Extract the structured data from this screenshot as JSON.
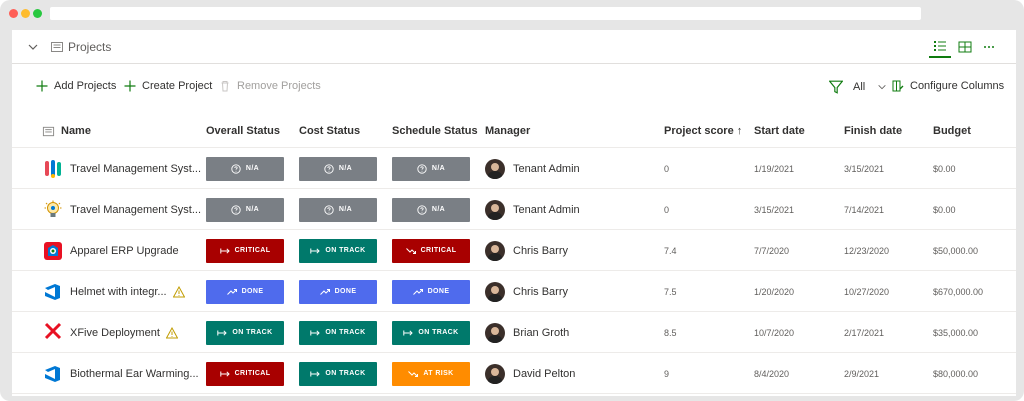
{
  "section": {
    "title": "Projects"
  },
  "toolbar": {
    "add": "Add Projects",
    "create": "Create Project",
    "remove": "Remove Projects",
    "filter": "All",
    "configure": "Configure Columns"
  },
  "columns": {
    "name": "Name",
    "overall": "Overall Status",
    "cost": "Cost Status",
    "schedule": "Schedule Status",
    "manager": "Manager",
    "score": "Project score",
    "score_sort": "↑",
    "start": "Start date",
    "finish": "Finish date",
    "budget": "Budget"
  },
  "colors": {
    "na": "#7a7f85",
    "critical": "#a80000",
    "ontrack": "#00796b",
    "done": "#4f6bed",
    "atrisk": "#ff8c00",
    "accent_green": "#107c10"
  },
  "rows": [
    {
      "name": "Travel Management Syst...",
      "icon": "travel-icon",
      "warning": false,
      "overall": "N/A",
      "overall_kind": "na",
      "cost": "N/A",
      "cost_kind": "na",
      "schedule": "N/A",
      "schedule_kind": "na",
      "manager": "Tenant Admin",
      "score": "0",
      "start": "1/19/2021",
      "finish": "3/15/2021",
      "budget": "$0.00"
    },
    {
      "name": "Travel Management Syst...",
      "icon": "idea-icon",
      "warning": false,
      "overall": "N/A",
      "overall_kind": "na",
      "cost": "N/A",
      "cost_kind": "na",
      "schedule": "N/A",
      "schedule_kind": "na",
      "manager": "Tenant Admin",
      "score": "0",
      "start": "3/15/2021",
      "finish": "7/14/2021",
      "budget": "$0.00"
    },
    {
      "name": "Apparel ERP Upgrade",
      "icon": "apparel-icon",
      "warning": false,
      "overall": "CRITICAL",
      "overall_kind": "critical",
      "cost": "ON TRACK",
      "cost_kind": "ontrack",
      "schedule": "CRITICAL",
      "schedule_kind": "critical",
      "manager": "Chris Barry",
      "score": "7.4",
      "start": "7/7/2020",
      "finish": "12/23/2020",
      "budget": "$50,000.00"
    },
    {
      "name": "Helmet with integr...",
      "icon": "azure-icon",
      "warning": true,
      "overall": "DONE",
      "overall_kind": "done",
      "cost": "DONE",
      "cost_kind": "done",
      "schedule": "DONE",
      "schedule_kind": "done",
      "manager": "Chris Barry",
      "score": "7.5",
      "start": "1/20/2020",
      "finish": "10/27/2020",
      "budget": "$670,000.00"
    },
    {
      "name": "XFive Deployment",
      "icon": "xfive-icon",
      "warning": true,
      "overall": "ON TRACK",
      "overall_kind": "ontrack",
      "cost": "ON TRACK",
      "cost_kind": "ontrack",
      "schedule": "ON TRACK",
      "schedule_kind": "ontrack",
      "manager": "Brian Groth",
      "score": "8.5",
      "start": "10/7/2020",
      "finish": "2/17/2021",
      "budget": "$35,000.00"
    },
    {
      "name": "Biothermal Ear Warming...",
      "icon": "azure-icon",
      "warning": false,
      "overall": "CRITICAL",
      "overall_kind": "critical",
      "cost": "ON TRACK",
      "cost_kind": "ontrack",
      "schedule": "AT RISK",
      "schedule_kind": "atrisk",
      "manager": "David Pelton",
      "score": "9",
      "start": "8/4/2020",
      "finish": "2/9/2021",
      "budget": "$80,000.00"
    }
  ]
}
